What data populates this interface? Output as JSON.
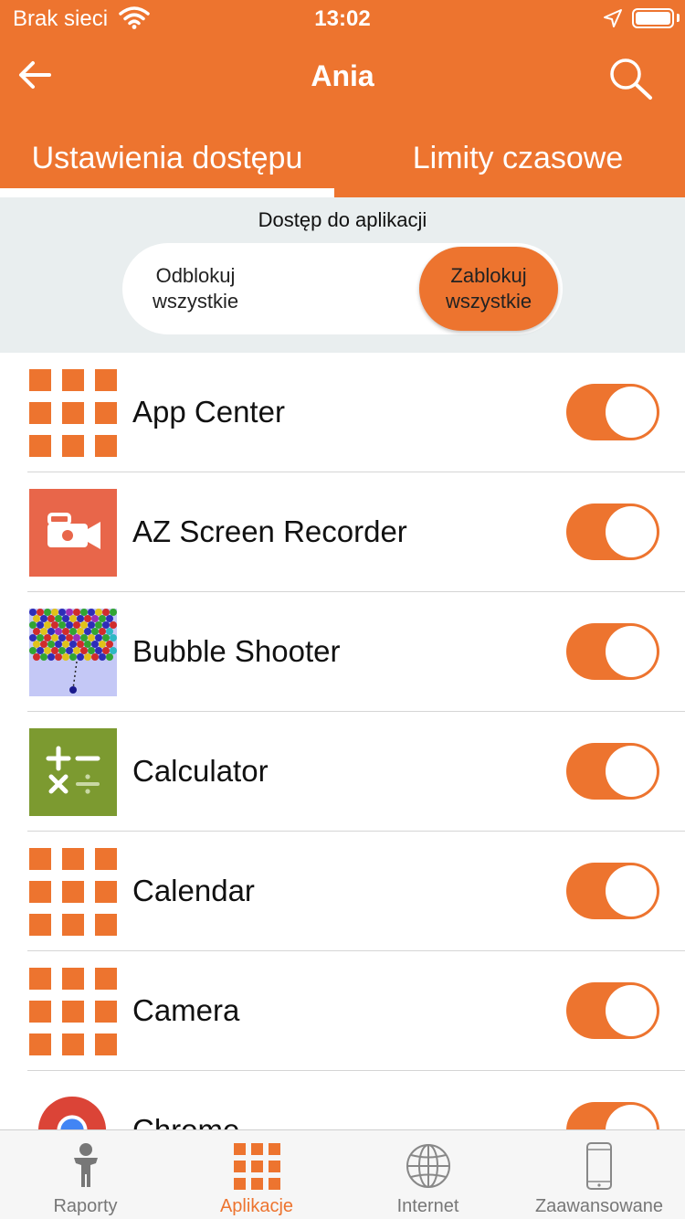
{
  "status_bar": {
    "carrier": "Brak sieci",
    "time": "13:02",
    "icons": [
      "wifi-icon",
      "location-arrow-icon",
      "battery-icon"
    ]
  },
  "header": {
    "title": "Ania",
    "back_icon": "arrow-left-icon",
    "search_icon": "search-icon"
  },
  "tabs": [
    {
      "label": "Ustawienia dostępu",
      "active": true
    },
    {
      "label": "Limity czasowe",
      "active": false
    }
  ],
  "access": {
    "label": "Dostęp do aplikacji",
    "unblock_label": "Odblokuj wszystkie",
    "block_label": "Zablokuj wszystkie",
    "selected": "Zablokuj wszystkie"
  },
  "apps": [
    {
      "name": "App Center",
      "icon": "grid-icon",
      "enabled": true
    },
    {
      "name": "AZ Screen Recorder",
      "icon": "video-camera-icon",
      "enabled": true
    },
    {
      "name": "Bubble Shooter",
      "icon": "bubble-shooter-icon",
      "enabled": true
    },
    {
      "name": "Calculator",
      "icon": "calculator-icon",
      "enabled": true
    },
    {
      "name": "Calendar",
      "icon": "grid-icon",
      "enabled": true
    },
    {
      "name": "Camera",
      "icon": "grid-icon",
      "enabled": true
    },
    {
      "name": "Chrome",
      "icon": "chrome-icon",
      "enabled": true
    }
  ],
  "bottom_nav": [
    {
      "label": "Raporty",
      "icon": "person-icon",
      "active": false
    },
    {
      "label": "Aplikacje",
      "icon": "grid-icon",
      "active": true
    },
    {
      "label": "Internet",
      "icon": "globe-icon",
      "active": false
    },
    {
      "label": "Zaawansowane",
      "icon": "phone-icon",
      "active": false
    }
  ],
  "colors": {
    "accent": "#ED742F",
    "segment_background": "#E9EEEF",
    "calculator_green": "#7C9A30",
    "recorder_red": "#E8664A"
  }
}
